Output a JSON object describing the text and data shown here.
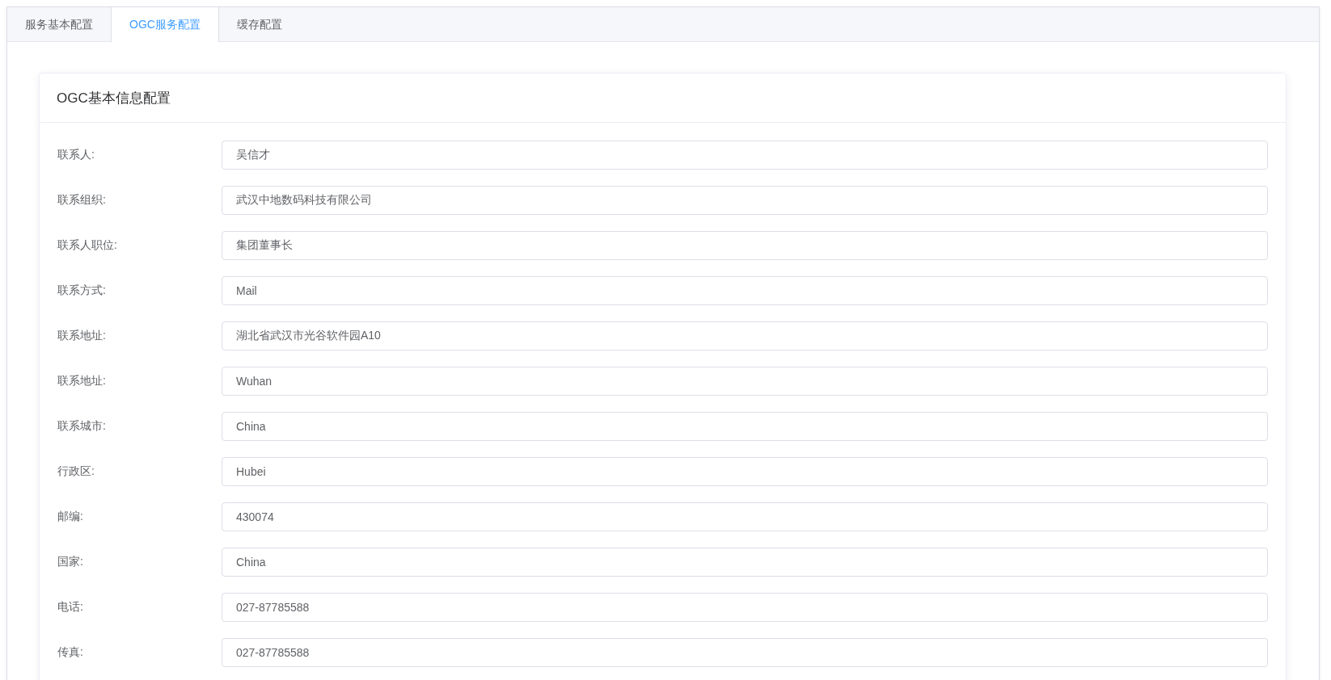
{
  "tabs": [
    {
      "label": "服务基本配置",
      "selected": false
    },
    {
      "label": "OGC服务配置",
      "selected": true
    },
    {
      "label": "缓存配置",
      "selected": false
    }
  ],
  "card": {
    "title": "OGC基本信息配置",
    "fields": [
      {
        "label": "联系人:",
        "value": "吴信才"
      },
      {
        "label": "联系组织:",
        "value": "武汉中地数码科技有限公司"
      },
      {
        "label": "联系人职位:",
        "value": "集团董事长"
      },
      {
        "label": "联系方式:",
        "value": "Mail"
      },
      {
        "label": "联系地址:",
        "value": "湖北省武汉市光谷软件园A10"
      },
      {
        "label": "联系地址:",
        "value": "Wuhan"
      },
      {
        "label": "联系城市:",
        "value": "China"
      },
      {
        "label": "行政区:",
        "value": "Hubei"
      },
      {
        "label": "邮编:",
        "value": "430074"
      },
      {
        "label": "国家:",
        "value": "China"
      },
      {
        "label": "电话:",
        "value": "027-87785588"
      },
      {
        "label": "传真:",
        "value": "027-87785588"
      }
    ]
  }
}
